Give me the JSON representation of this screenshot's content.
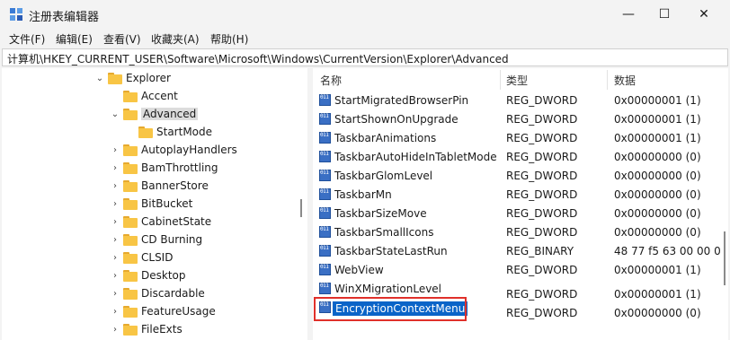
{
  "window": {
    "title": "注册表编辑器",
    "controls": {
      "minimize": "—",
      "maximize": "☐",
      "close": "✕"
    }
  },
  "menubar": [
    "文件(F)",
    "编辑(E)",
    "查看(V)",
    "收藏夹(A)",
    "帮助(H)"
  ],
  "address": "计算机\\HKEY_CURRENT_USER\\Software\\Microsoft\\Windows\\CurrentVersion\\Explorer\\Advanced",
  "tree": [
    {
      "label": "Explorer",
      "chevron": "⌄"
    },
    {
      "label": "Accent",
      "chevron": ""
    },
    {
      "label": "Advanced",
      "chevron": "⌄",
      "selected": true
    },
    {
      "label": "StartMode",
      "chevron": ""
    },
    {
      "label": "AutoplayHandlers",
      "chevron": "›"
    },
    {
      "label": "BamThrottling",
      "chevron": "›"
    },
    {
      "label": "BannerStore",
      "chevron": "›"
    },
    {
      "label": "BitBucket",
      "chevron": "›"
    },
    {
      "label": "CabinetState",
      "chevron": "›"
    },
    {
      "label": "CD Burning",
      "chevron": "›"
    },
    {
      "label": "CLSID",
      "chevron": "›"
    },
    {
      "label": "Desktop",
      "chevron": "›"
    },
    {
      "label": "Discardable",
      "chevron": "›"
    },
    {
      "label": "FeatureUsage",
      "chevron": "›"
    },
    {
      "label": "FileExts",
      "chevron": "›"
    }
  ],
  "columns": {
    "name": "名称",
    "type": "类型",
    "data": "数据"
  },
  "rows": [
    {
      "name": "StartMigratedBrowserPin",
      "type": "REG_DWORD",
      "data": "0x00000001 (1)"
    },
    {
      "name": "StartShownOnUpgrade",
      "type": "REG_DWORD",
      "data": "0x00000001 (1)"
    },
    {
      "name": "TaskbarAnimations",
      "type": "REG_DWORD",
      "data": "0x00000001 (1)"
    },
    {
      "name": "TaskbarAutoHideInTabletMode",
      "type": "REG_DWORD",
      "data": "0x00000000 (0)"
    },
    {
      "name": "TaskbarGlomLevel",
      "type": "REG_DWORD",
      "data": "0x00000000 (0)"
    },
    {
      "name": "TaskbarMn",
      "type": "REG_DWORD",
      "data": "0x00000000 (0)"
    },
    {
      "name": "TaskbarSizeMove",
      "type": "REG_DWORD",
      "data": "0x00000000 (0)"
    },
    {
      "name": "TaskbarSmallIcons",
      "type": "REG_DWORD",
      "data": "0x00000000 (0)"
    },
    {
      "name": "TaskbarStateLastRun",
      "type": "REG_BINARY",
      "data": "48 77 f5 63 00 00 0"
    },
    {
      "name": "WebView",
      "type": "REG_DWORD",
      "data": "0x00000001 (1)"
    },
    {
      "name": "WinXMigrationLevel",
      "type": "REG_DWORD",
      "data": "0x00000001 (1)"
    },
    {
      "name": "EncryptionContextMenu",
      "type": "REG_DWORD",
      "data": "0x00000000 (0)",
      "selected": true
    }
  ],
  "colors": {
    "selection": "#0a64c8",
    "highlight_box": "#e0302a",
    "folder": "#f8c545"
  }
}
